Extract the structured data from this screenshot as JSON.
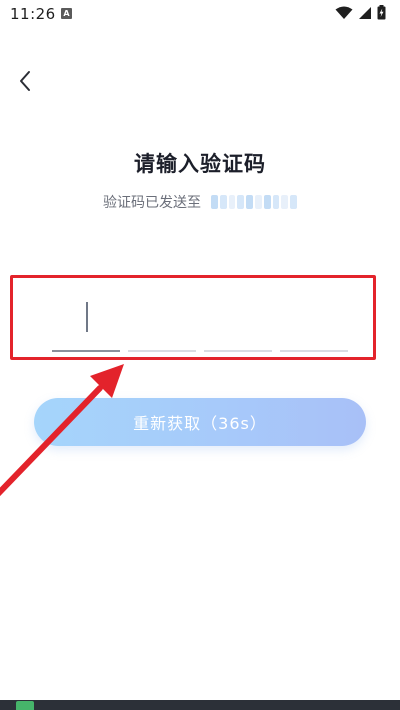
{
  "status_bar": {
    "time": "11:26",
    "notification_icon": "A"
  },
  "header": {
    "back_icon": "chevron-left-icon"
  },
  "main": {
    "title": "请输入验证码",
    "subtitle": "验证码已发送至",
    "code_length": 4,
    "active_cell": 1
  },
  "resend": {
    "label": "重新获取（36s）"
  },
  "colors": {
    "accent_gradient_start": "#a5d5fb",
    "accent_gradient_end": "#a8c0f7",
    "annotation_red": "#e3232b"
  }
}
